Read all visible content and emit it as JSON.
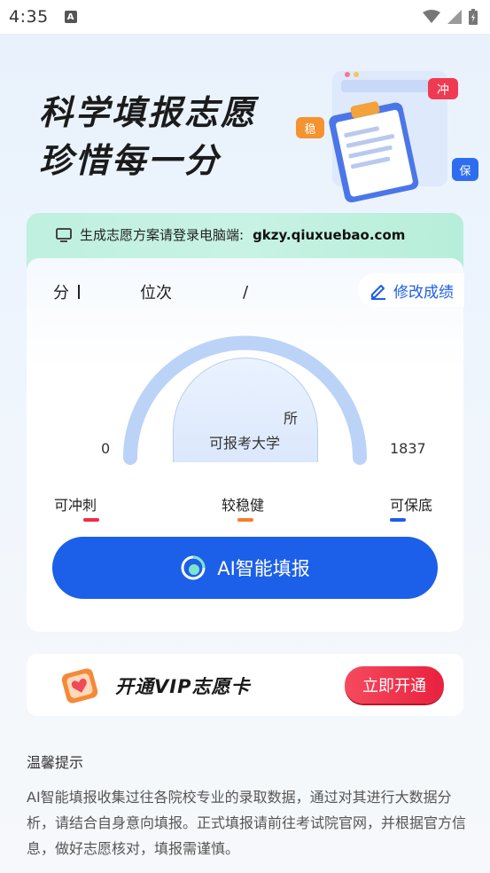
{
  "status_bar": {
    "time": "4:35",
    "notification_icon": "a-icon",
    "signal_icons": [
      "wifi-icon",
      "cell-signal-icon",
      "battery-icon"
    ]
  },
  "hero": {
    "title_line1": "科学填报志愿",
    "title_line2": "珍惜每一分",
    "tags": {
      "chong": "冲",
      "wen": "稳",
      "bao": "保"
    }
  },
  "banner": {
    "text": "生成志愿方案请登录电脑端:",
    "url": "gkzy.qiuxuebao.com"
  },
  "score": {
    "score_label": "分",
    "rank_label": "位次",
    "slash": "/",
    "edit_label": "修改成绩"
  },
  "gauge": {
    "count_unit": "所",
    "caption": "可报考大学",
    "min": "0",
    "max": "1837"
  },
  "legend": {
    "chong": "可冲刺",
    "wen": "较稳健",
    "bao": "可保底"
  },
  "ai_button": {
    "label": "AI智能填报"
  },
  "vip": {
    "title": "开通VIP志愿卡",
    "button": "立即开通"
  },
  "tips": {
    "title": "温馨提示",
    "body": "AI智能填报收集过往各院校专业的录取数据，通过对其进行大数据分析，请结合自身意向填报。正式填报请前往考试院官网，并根据官方信息，做好志愿核对，填报需谨慎。"
  },
  "colors": {
    "primary_blue": "#1c5fe8",
    "chong_red": "#ef2c4b",
    "wen_orange": "#f57d2b",
    "bao_blue": "#1e5ee6",
    "banner_green": "#c8f2e4"
  }
}
